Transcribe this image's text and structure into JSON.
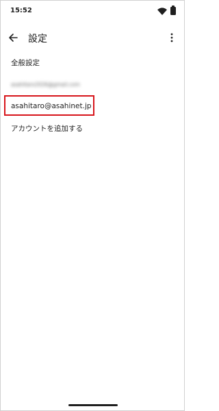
{
  "status_bar": {
    "time": "15:52",
    "icons": [
      "wifi-icon",
      "battery-icon"
    ]
  },
  "app_bar": {
    "back_icon": "arrow-back-icon",
    "title": "設定",
    "menu_icon": "more-vert-icon"
  },
  "list": {
    "general_settings": "全般設定",
    "blurred_account": "asahitaro2026@gmail.com",
    "selected_account": "asahitaro@asahinet.jp",
    "add_account": "アカウントを追加する"
  },
  "colors": {
    "highlight_border": "#d7141a",
    "text": "#1f1f1f",
    "background": "#ffffff"
  }
}
